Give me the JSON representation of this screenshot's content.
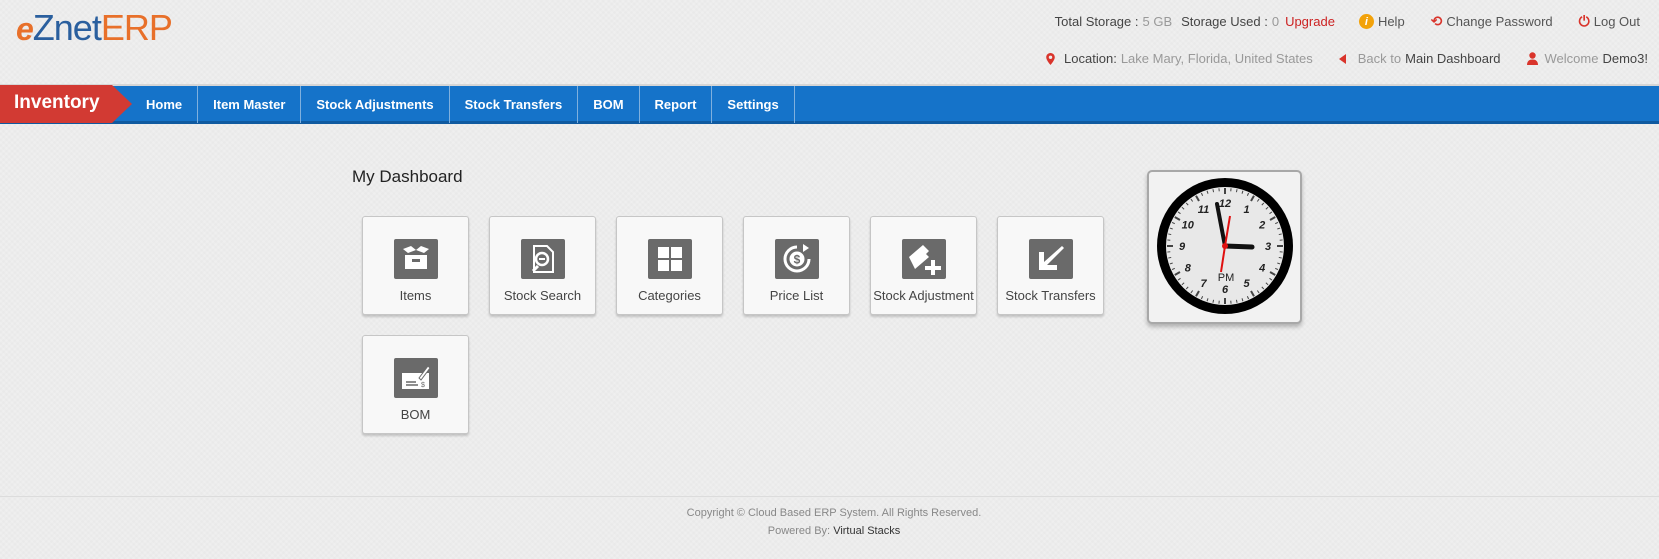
{
  "brand": {
    "e": "e",
    "znet": "Znet",
    "erp": "ERP"
  },
  "topbar": {
    "total_storage_label": "Total Storage :",
    "total_storage_value": "5 GB",
    "storage_used_label": "Storage Used :",
    "storage_used_value": "0",
    "upgrade": "Upgrade",
    "help": "Help",
    "change_password": "Change Password",
    "logout": "Log Out"
  },
  "subbar": {
    "location_label": "Location:",
    "location_value": "Lake Mary, Florida, United States",
    "back_to": "Back to",
    "main_dashboard": "Main Dashboard",
    "welcome": "Welcome",
    "user": "Demo3!"
  },
  "nav": {
    "module": "Inventory",
    "items": [
      "Home",
      "Item Master",
      "Stock Adjustments",
      "Stock Transfers",
      "BOM",
      "Report",
      "Settings"
    ]
  },
  "dashboard": {
    "title": "My Dashboard",
    "tiles": [
      "Items",
      "Stock Search",
      "Categories",
      "Price List",
      "Stock Adjustment",
      "Stock Transfers",
      "BOM"
    ]
  },
  "clock": {
    "period": "PM",
    "numerals": [
      "12",
      "1",
      "2",
      "3",
      "4",
      "5",
      "6",
      "7",
      "8",
      "9",
      "10",
      "11"
    ]
  },
  "footer": {
    "copyright": "Copyright © Cloud Based ERP System. All Rights Reserved.",
    "powered_label": "Powered By:",
    "powered_value": "Virtual Stacks"
  },
  "colors": {
    "nav_blue": "#1573c9",
    "module_red": "#d23a33",
    "brand_orange": "#e8702a",
    "brand_blue": "#2a5f9e",
    "link_red": "#cc2222"
  }
}
